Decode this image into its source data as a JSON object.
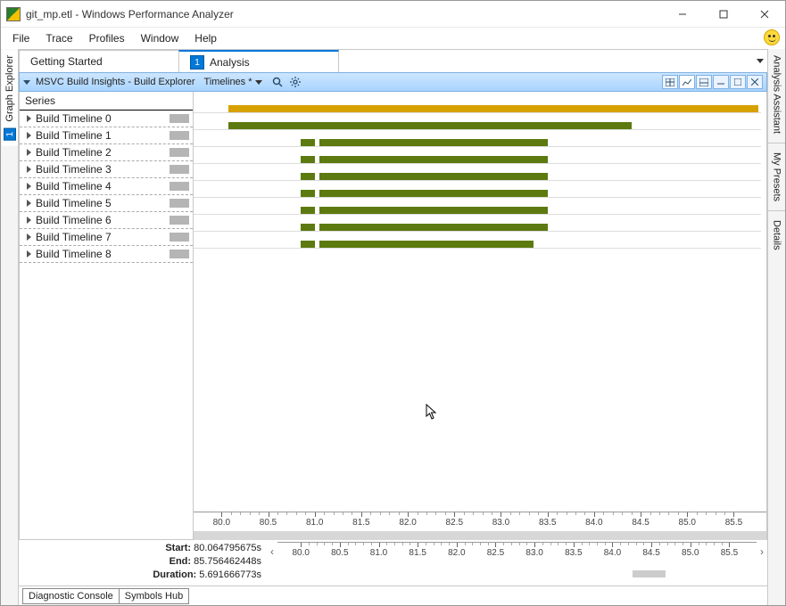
{
  "window": {
    "title": "git_mp.etl - Windows Performance Analyzer"
  },
  "menu": {
    "file": "File",
    "trace": "Trace",
    "profiles": "Profiles",
    "window": "Window",
    "help": "Help"
  },
  "sidetabs": {
    "left": {
      "num": "1",
      "label": "Graph Explorer"
    },
    "right": {
      "assistant": "Analysis Assistant",
      "presets": "My Presets",
      "details": "Details"
    }
  },
  "tabs": {
    "getting_started": "Getting Started",
    "analysis_num": "1",
    "analysis": "Analysis"
  },
  "panel": {
    "title": "MSVC Build Insights - Build Explorer",
    "dropdown": "Timelines *"
  },
  "series": {
    "header": "Series",
    "items": [
      {
        "label": "Build Timeline 0"
      },
      {
        "label": "Build Timeline 1"
      },
      {
        "label": "Build Timeline 2"
      },
      {
        "label": "Build Timeline 3"
      },
      {
        "label": "Build Timeline 4"
      },
      {
        "label": "Build Timeline 5"
      },
      {
        "label": "Build Timeline 6"
      },
      {
        "label": "Build Timeline 7"
      },
      {
        "label": "Build Timeline 8"
      }
    ]
  },
  "axis_ticks": [
    "80.0",
    "80.5",
    "81.0",
    "81.5",
    "82.0",
    "82.5",
    "83.0",
    "83.5",
    "84.0",
    "84.5",
    "85.0",
    "85.5"
  ],
  "meta": {
    "start_label": "Start:",
    "start": "80.064795675s",
    "end_label": "End:",
    "end": "85.756462448s",
    "dur_label": "Duration:",
    "dur": "5.691666773s"
  },
  "footer": {
    "diag": "Diagnostic Console",
    "sym": "Symbols Hub"
  },
  "colors": {
    "gold": "#d7a100",
    "olive": "#5c7a0f",
    "accent": "#0078d7"
  },
  "chart_data": {
    "type": "bar",
    "xlabel": "",
    "ylabel": "",
    "xlim": [
      79.7,
      85.85
    ],
    "series": [
      {
        "name": "Build Timeline 0",
        "color": "gold",
        "segments": [
          {
            "start": 80.07,
            "end": 85.76
          }
        ]
      },
      {
        "name": "Build Timeline 1",
        "color": "olive",
        "segments": [
          {
            "start": 80.07,
            "end": 84.4
          }
        ]
      },
      {
        "name": "Build Timeline 2",
        "color": "olive",
        "segments": [
          {
            "start": 80.85,
            "end": 81.0
          },
          {
            "start": 81.05,
            "end": 83.5
          }
        ]
      },
      {
        "name": "Build Timeline 3",
        "color": "olive",
        "segments": [
          {
            "start": 80.85,
            "end": 81.0
          },
          {
            "start": 81.05,
            "end": 83.5
          }
        ]
      },
      {
        "name": "Build Timeline 4",
        "color": "olive",
        "segments": [
          {
            "start": 80.85,
            "end": 81.0
          },
          {
            "start": 81.05,
            "end": 83.5
          }
        ]
      },
      {
        "name": "Build Timeline 5",
        "color": "olive",
        "segments": [
          {
            "start": 80.85,
            "end": 81.0
          },
          {
            "start": 81.05,
            "end": 83.5
          }
        ]
      },
      {
        "name": "Build Timeline 6",
        "color": "olive",
        "segments": [
          {
            "start": 80.85,
            "end": 81.0
          },
          {
            "start": 81.05,
            "end": 83.5
          }
        ]
      },
      {
        "name": "Build Timeline 7",
        "color": "olive",
        "segments": [
          {
            "start": 80.85,
            "end": 81.0
          },
          {
            "start": 81.05,
            "end": 83.5
          }
        ]
      },
      {
        "name": "Build Timeline 8",
        "color": "olive",
        "segments": [
          {
            "start": 80.85,
            "end": 81.0
          },
          {
            "start": 81.05,
            "end": 83.35
          }
        ]
      }
    ]
  }
}
